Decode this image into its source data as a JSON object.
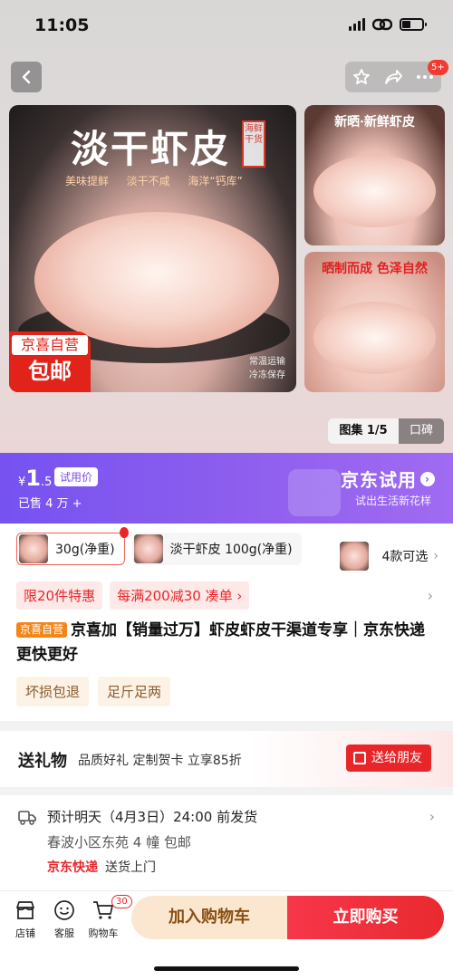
{
  "status_bar": {
    "time": "11:05"
  },
  "gallery": {
    "main_title": "淡干虾皮",
    "seal": "海鲜干货",
    "tags": [
      "美味提鲜",
      "淡干不咸",
      "海洋“钙库”"
    ],
    "badge_top": "京喜自营",
    "badge_bottom": "包邮",
    "note_line1": "常温运输",
    "note_line2": "冷冻保存",
    "side1_caption": "新晒·新鲜虾皮",
    "side2_caption": "晒制而成 色泽自然",
    "tab_gallery": "图集 1/5",
    "tab_reviews": "口碑",
    "message_count": "5+"
  },
  "trial": {
    "currency": "¥",
    "price_int": "1",
    "price_dec": ".5",
    "trial_label": "试用价",
    "sold": "已售 4 万 +",
    "brand": "京东试用",
    "slogan": "试出生活新花样"
  },
  "variants": [
    {
      "label": "30g(净重)"
    },
    {
      "label": "淡干虾皮 100g(净重)"
    },
    {
      "label": "4款可选"
    }
  ],
  "promos": [
    "限20件特惠",
    "每满200减30  凑单 ›"
  ],
  "product": {
    "self_tag": "京喜自营",
    "title": "京喜加【销量过万】虾皮虾皮干渠道专享｜京东快递 更快更好",
    "badges": [
      "坏损包退",
      "足斤足两"
    ]
  },
  "gift": {
    "heading": "送礼物",
    "desc": "品质好礼 定制贺卡 立享85折",
    "button": "送给朋友"
  },
  "delivery": {
    "line1": "预计明天（4月3日）24:00 前发货",
    "line2": "春波小区东苑 4 幢  包邮",
    "carrier": "京东快递",
    "service": "送货上门"
  },
  "bottom_bar": {
    "store": "店铺",
    "service": "客服",
    "cart": "购物车",
    "cart_count": "30",
    "add_to_cart": "加入购物车",
    "buy_now": "立即购买"
  },
  "colors": {
    "accent_red": "#e8262a",
    "trial_purple": "#8a5cf0",
    "gold": "#fbe7cf"
  }
}
